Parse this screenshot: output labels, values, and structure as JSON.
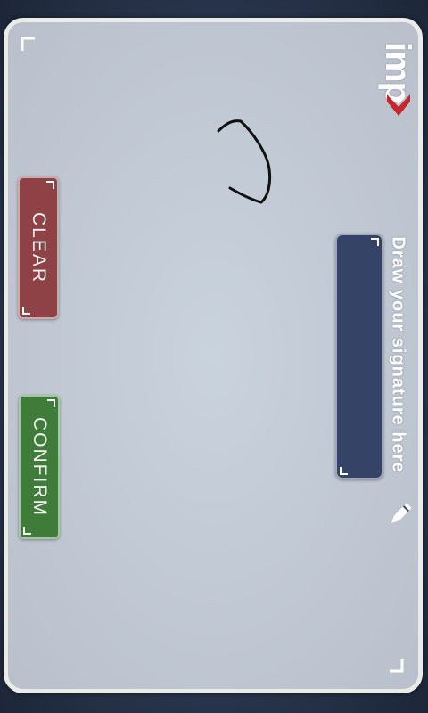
{
  "app": {
    "logo_text": "imp",
    "logo_icon": "brand-chevron-logo"
  },
  "signature": {
    "instruction": "Draw your signature here",
    "instruction_icon": "pen-icon"
  },
  "actions": {
    "clear_label": "CLEAR",
    "confirm_label": "CONFIRM"
  },
  "colors": {
    "panel_border": "#e9ebe8",
    "clear_button": "#8e4246",
    "confirm_button": "#3f7c3a",
    "hint_box": "#344366",
    "logo_accent": "#c8252c",
    "stroke": "#111111"
  }
}
